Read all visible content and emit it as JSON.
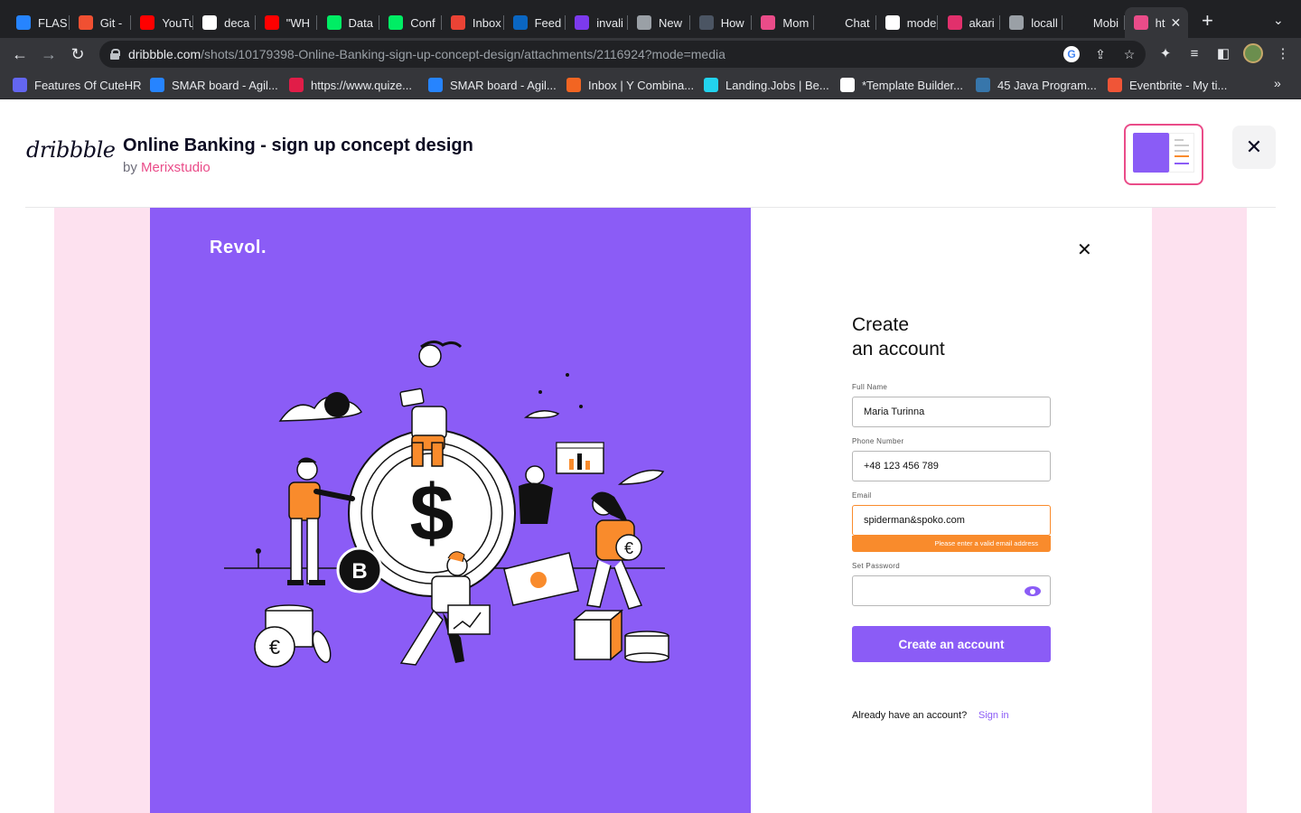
{
  "browser": {
    "tabs": [
      {
        "title": "FLAS",
        "icon": "jira-icon",
        "color": "#2684ff"
      },
      {
        "title": "Git -",
        "icon": "git-icon",
        "color": "#f05032"
      },
      {
        "title": "YouTu",
        "icon": "youtube-icon",
        "color": "#ff0000"
      },
      {
        "title": "deca",
        "icon": "github-icon",
        "color": "#ffffff"
      },
      {
        "title": "\"WH",
        "icon": "youtube-icon",
        "color": "#ff0000"
      },
      {
        "title": "Data",
        "icon": "mongodb-icon",
        "color": "#00ed64"
      },
      {
        "title": "Conf",
        "icon": "mongodb-icon",
        "color": "#00ed64"
      },
      {
        "title": "Inbox",
        "icon": "gmail-icon",
        "color": "#ea4335"
      },
      {
        "title": "Feed",
        "icon": "linkedin-icon",
        "color": "#0a66c2"
      },
      {
        "title": "invali",
        "icon": "app-icon",
        "color": "#7c3aed"
      },
      {
        "title": "New",
        "icon": "chrome-icon",
        "color": "#9aa0a6"
      },
      {
        "title": "How",
        "icon": "ai-icon",
        "color": "#4b5563"
      },
      {
        "title": "Mom",
        "icon": "dribbble-icon",
        "color": "#ea4c89"
      },
      {
        "title": "Chat",
        "icon": "openai-icon",
        "color": "#202124"
      },
      {
        "title": "mode",
        "icon": "google-icon",
        "color": "#ffffff"
      },
      {
        "title": "akari",
        "icon": "instagram-icon",
        "color": "#e1306c"
      },
      {
        "title": "locall",
        "icon": "globe-icon",
        "color": "#9aa0a6"
      },
      {
        "title": "Mobi",
        "icon": "app-icon",
        "color": "#202124"
      },
      {
        "title": "ht",
        "icon": "dribbble-icon",
        "color": "#ea4c89"
      }
    ],
    "url_host": "dribbble.com",
    "url_path": "/shots/10179398-Online-Banking-sign-up-concept-design/attachments/2116924?mode=media",
    "bookmarks": [
      {
        "label": "Features Of CuteHR",
        "icon": "cutehr-icon",
        "color": "#6366f1"
      },
      {
        "label": "SMAR board - Agil...",
        "icon": "jira-icon",
        "color": "#2684ff"
      },
      {
        "label": "https://www.quize...",
        "icon": "quiz-icon",
        "color": "#e11d48"
      },
      {
        "label": "SMAR board - Agil...",
        "icon": "jira-icon",
        "color": "#2684ff"
      },
      {
        "label": "Inbox | Y Combina...",
        "icon": "ycombinator-icon",
        "color": "#f26522"
      },
      {
        "label": "Landing.Jobs | Be...",
        "icon": "landingjobs-icon",
        "color": "#22d3ee"
      },
      {
        "label": "*Template Builder...",
        "icon": "webflow-icon",
        "color": "#ffffff"
      },
      {
        "label": "45 Java Program...",
        "icon": "python-icon",
        "color": "#3776ab"
      },
      {
        "label": "Eventbrite - My ti...",
        "icon": "eventbrite-icon",
        "color": "#f05537"
      }
    ]
  },
  "dribbble": {
    "logo": "dribbble",
    "title": "Online Banking - sign up concept design",
    "by_prefix": "by ",
    "author": "Merixstudio"
  },
  "shot": {
    "brand": "Revol.",
    "form": {
      "title_line1": "Create",
      "title_line2": "an account",
      "full_name_label": "Full Name",
      "full_name_value": "Maria Turinna",
      "phone_label": "Phone Number",
      "phone_value": "+48 123 456 789",
      "email_label": "Email",
      "email_value": "spiderman&spoko.com",
      "email_error": "Please enter a valid email address",
      "password_label": "Set Password",
      "password_value": "",
      "submit_label": "Create an account",
      "already_text": "Already have an account?",
      "signin_label": "Sign in"
    }
  },
  "colors": {
    "accent_purple": "#8b5cf6",
    "error_orange": "#f98b2c",
    "dribbble_pink": "#ea4c89",
    "shot_background": "#fde1ef"
  }
}
